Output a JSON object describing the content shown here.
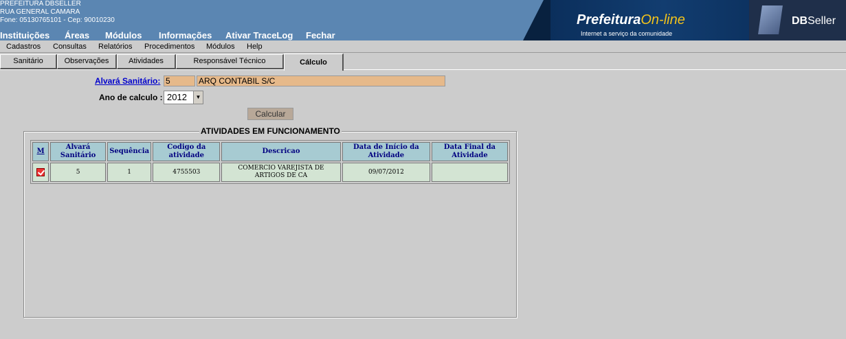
{
  "header": {
    "org_name": "PREFEITURA DBSELLER",
    "address": "RUA GENERAL CAMARA",
    "contact": "Fone: 05130765101  -  Cep: 90010230",
    "nav": [
      "Instituições",
      "Áreas",
      "Módulos",
      "Informações",
      "Ativar TraceLog",
      "Fechar"
    ],
    "logo_main": "Prefeitura",
    "logo_online": "On-line",
    "logo_sub": "Internet a serviço da comunidade",
    "dbseller_bold": "DB",
    "dbseller_rest": "Seller"
  },
  "menu": [
    "Cadastros",
    "Consultas",
    "Relatórios",
    "Procedimentos",
    "Módulos",
    "Help"
  ],
  "tabs": [
    "Sanitário",
    "Observações",
    "Atividades",
    "Responsável Técnico",
    "Cálculo"
  ],
  "form": {
    "alvara_label": "Alvará Sanitário:",
    "alvara_number": "5",
    "alvara_name": "ARQ CONTABIL S/C",
    "ano_label": "Ano de calculo :",
    "ano_value": "2012",
    "calc_button": "Calcular"
  },
  "activities": {
    "legend": "ATIVIDADES EM FUNCIONAMENTO",
    "columns": [
      "M",
      "Alvará Sanitário",
      "Sequência",
      "Codigo da atividade",
      "Descricao",
      "Data de Início da Atividade",
      "Data Final da Atividade"
    ],
    "rows": [
      {
        "checked": true,
        "alvara": "5",
        "sequencia": "1",
        "codigo": "4755503",
        "descricao": "COMERCIO VAREJISTA DE ARTIGOS DE CA",
        "data_inicio": "09/07/2012",
        "data_final": ""
      }
    ]
  }
}
